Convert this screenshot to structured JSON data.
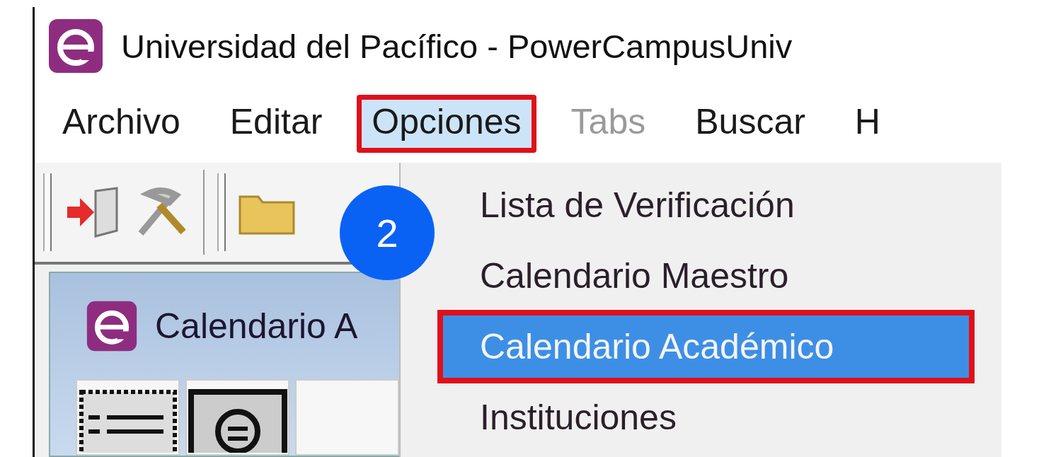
{
  "window": {
    "title": "Universidad del Pacífico - PowerCampusUniv"
  },
  "menu_bar": [
    {
      "label": "Archivo",
      "selected": false,
      "disabled": false,
      "annotated": false
    },
    {
      "label": "Editar",
      "selected": false,
      "disabled": false,
      "annotated": false
    },
    {
      "label": "Opciones",
      "selected": true,
      "disabled": false,
      "annotated": true
    },
    {
      "label": "Tabs",
      "selected": false,
      "disabled": true,
      "annotated": false
    },
    {
      "label": "Buscar",
      "selected": false,
      "disabled": false,
      "annotated": false
    },
    {
      "label": "H",
      "selected": false,
      "disabled": false,
      "annotated": false
    }
  ],
  "dropdown": [
    {
      "label": "Lista de Verificación",
      "selected": false,
      "annotated": false
    },
    {
      "label": "Calendario Maestro",
      "selected": false,
      "annotated": false
    },
    {
      "label": "Calendario Académico",
      "selected": true,
      "annotated": true
    },
    {
      "label": "Instituciones",
      "selected": false,
      "annotated": false
    }
  ],
  "child_window": {
    "title": "Calendario A"
  },
  "step_badge": "2"
}
